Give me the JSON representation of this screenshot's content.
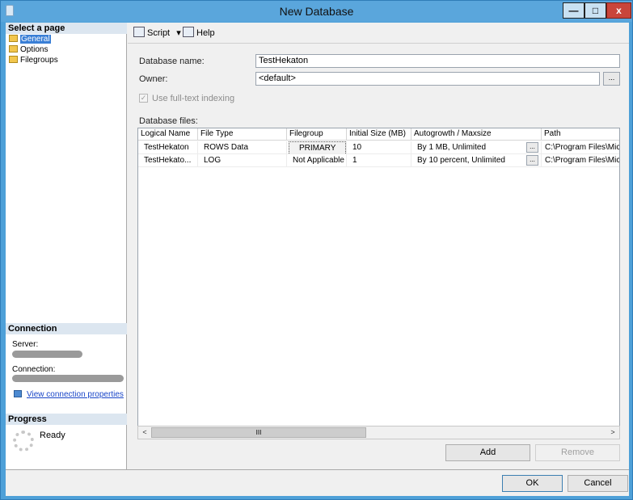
{
  "window": {
    "title": "New Database",
    "minimize_glyph": "—",
    "maximize_glyph": "□",
    "close_glyph": "x"
  },
  "left_panel": {
    "select_page_header": "Select a page",
    "pages": [
      {
        "label": "General",
        "selected": true
      },
      {
        "label": "Options",
        "selected": false
      },
      {
        "label": "Filegroups",
        "selected": false
      }
    ],
    "connection_header": "Connection",
    "server_label": "Server:",
    "connection_label": "Connection:",
    "view_connection_link": "View connection properties",
    "progress_header": "Progress",
    "progress_status": "Ready"
  },
  "toolbar": {
    "script_label": "Script",
    "script_dropdown_glyph": "▾",
    "help_label": "Help"
  },
  "form": {
    "database_name_label": "Database name:",
    "database_name_value": "TestHekaton",
    "owner_label": "Owner:",
    "owner_value": "<default>",
    "ellipsis": "...",
    "fulltext_label": "Use full-text indexing",
    "fulltext_checked": true,
    "database_files_label": "Database files:"
  },
  "grid": {
    "columns": [
      "Logical Name",
      "File Type",
      "Filegroup",
      "Initial Size (MB)",
      "Autogrowth / Maxsize",
      "Path"
    ],
    "rows": [
      [
        "TestHekaton",
        "ROWS Data",
        "PRIMARY",
        "10",
        "By 1 MB, Unlimited",
        "C:\\Program Files\\Micro"
      ],
      [
        "TestHekato...",
        "LOG",
        "Not Applicable",
        "1",
        "By 10 percent, Unlimited",
        "C:\\Program Files\\Micro"
      ]
    ],
    "ellipsis": "...",
    "scroll_left": "<",
    "scroll_right": ">",
    "scroll_grip": "III"
  },
  "buttons": {
    "add": "Add",
    "remove": "Remove",
    "ok": "OK",
    "cancel": "Cancel"
  },
  "colors": {
    "title_bar": "#5aa6dc",
    "close_button": "#c9453a",
    "selected_page": "#3a7fd6",
    "link": "#1845c8"
  }
}
